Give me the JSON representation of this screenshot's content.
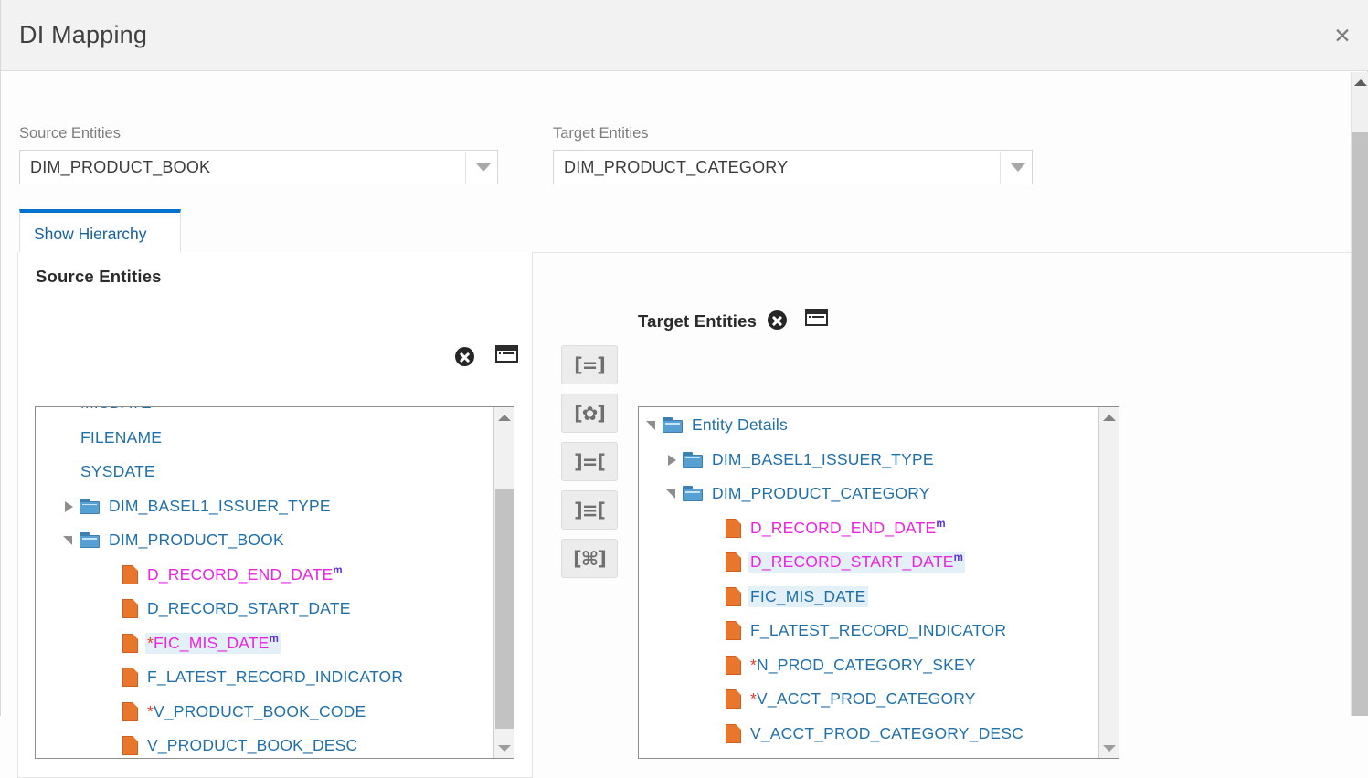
{
  "dialog": {
    "title": "DI Mapping",
    "close_label": "✕"
  },
  "source_field": {
    "label": "Source Entities",
    "value": "DIM_PRODUCT_BOOK"
  },
  "target_field": {
    "label": "Target Entities",
    "value": "DIM_PRODUCT_CATEGORY"
  },
  "tabs": [
    {
      "label": "Show Hierarchy",
      "active": true
    }
  ],
  "source_panel": {
    "title": "Source Entities",
    "clear_icon": "circle-x-icon",
    "list_icon": "list-view-icon",
    "tree": [
      {
        "indent": 1,
        "type": "leaf",
        "text": "MISDATE",
        "color": "blue",
        "asterisk": false,
        "sup": "",
        "selected": false,
        "twisty": "none",
        "partial_top": true
      },
      {
        "indent": 1,
        "type": "leaf",
        "text": "FILENAME",
        "color": "blue",
        "asterisk": false,
        "sup": "",
        "selected": false,
        "twisty": "none"
      },
      {
        "indent": 1,
        "type": "leaf",
        "text": "SYSDATE",
        "color": "blue",
        "asterisk": false,
        "sup": "",
        "selected": false,
        "twisty": "none"
      },
      {
        "indent": 2,
        "type": "folder",
        "text": "DIM_BASEL1_ISSUER_TYPE",
        "color": "blue",
        "asterisk": false,
        "sup": "",
        "selected": false,
        "twisty": "collapsed"
      },
      {
        "indent": 2,
        "type": "folder",
        "text": "DIM_PRODUCT_BOOK",
        "color": "blue",
        "asterisk": false,
        "sup": "",
        "selected": false,
        "twisty": "expanded"
      },
      {
        "indent": 3,
        "type": "leaf",
        "text": "D_RECORD_END_DATE",
        "color": "magenta",
        "asterisk": false,
        "sup": "m",
        "selected": false,
        "twisty": "none"
      },
      {
        "indent": 3,
        "type": "leaf",
        "text": "D_RECORD_START_DATE",
        "color": "blue",
        "asterisk": false,
        "sup": "",
        "selected": false,
        "twisty": "none"
      },
      {
        "indent": 3,
        "type": "leaf",
        "text": "FIC_MIS_DATE",
        "color": "magenta",
        "asterisk": true,
        "sup": "m",
        "selected": true,
        "twisty": "none"
      },
      {
        "indent": 3,
        "type": "leaf",
        "text": "F_LATEST_RECORD_INDICATOR",
        "color": "blue",
        "asterisk": false,
        "sup": "",
        "selected": false,
        "twisty": "none"
      },
      {
        "indent": 3,
        "type": "leaf",
        "text": "V_PRODUCT_BOOK_CODE",
        "color": "blue",
        "asterisk": true,
        "sup": "",
        "selected": false,
        "twisty": "none"
      },
      {
        "indent": 3,
        "type": "leaf",
        "text": "V_PRODUCT_BOOK_DESC",
        "color": "blue",
        "asterisk": false,
        "sup": "",
        "selected": false,
        "twisty": "none"
      }
    ],
    "scrollbar": {
      "up": "scroll-up-arrow",
      "down": "scroll-down-arrow"
    }
  },
  "target_panel": {
    "title": "Target Entities",
    "clear_icon": "circle-x-icon",
    "list_icon": "list-view-icon",
    "tree": [
      {
        "indent": 0,
        "type": "folder",
        "text": "Entity Details",
        "color": "blue",
        "asterisk": false,
        "sup": "",
        "selected": false,
        "twisty": "expanded"
      },
      {
        "indent": 2,
        "type": "folder",
        "text": "DIM_BASEL1_ISSUER_TYPE",
        "color": "blue",
        "asterisk": false,
        "sup": "",
        "selected": false,
        "twisty": "collapsed"
      },
      {
        "indent": 2,
        "type": "folder",
        "text": "DIM_PRODUCT_CATEGORY",
        "color": "blue",
        "asterisk": false,
        "sup": "",
        "selected": false,
        "twisty": "expanded"
      },
      {
        "indent": 3,
        "type": "leaf",
        "text": "D_RECORD_END_DATE",
        "color": "magenta",
        "asterisk": false,
        "sup": "m",
        "selected": false,
        "twisty": "none"
      },
      {
        "indent": 3,
        "type": "leaf",
        "text": "D_RECORD_START_DATE",
        "color": "magenta",
        "asterisk": false,
        "sup": "m",
        "selected": true,
        "twisty": "none"
      },
      {
        "indent": 3,
        "type": "leaf",
        "text": "FIC_MIS_DATE",
        "color": "blue",
        "asterisk": false,
        "sup": "",
        "selected": true,
        "twisty": "none"
      },
      {
        "indent": 3,
        "type": "leaf",
        "text": "F_LATEST_RECORD_INDICATOR",
        "color": "blue",
        "asterisk": false,
        "sup": "",
        "selected": false,
        "twisty": "none"
      },
      {
        "indent": 3,
        "type": "leaf",
        "text": "N_PROD_CATEGORY_SKEY",
        "color": "blue",
        "asterisk": true,
        "sup": "",
        "selected": false,
        "twisty": "none"
      },
      {
        "indent": 3,
        "type": "leaf",
        "text": "V_ACCT_PROD_CATEGORY",
        "color": "blue",
        "asterisk": true,
        "sup": "",
        "selected": false,
        "twisty": "none"
      },
      {
        "indent": 3,
        "type": "leaf",
        "text": "V_ACCT_PROD_CATEGORY_DESC",
        "color": "blue",
        "asterisk": false,
        "sup": "",
        "selected": false,
        "twisty": "none"
      }
    ],
    "scrollbar": {
      "up": "scroll-up-arrow",
      "down": "scroll-down-arrow"
    }
  },
  "op_buttons": [
    {
      "glyph": "[=]",
      "name": "map-equal-button"
    },
    {
      "glyph": "[✿]",
      "name": "map-function-button"
    },
    {
      "glyph": "]=[",
      "name": "unmap-equal-button"
    },
    {
      "glyph": "]≡[",
      "name": "unmap-all-button"
    },
    {
      "glyph": "[⌘]",
      "name": "auto-map-button"
    }
  ],
  "colors": {
    "accent": "#0572ce",
    "tab_text": "#16609e",
    "node_blue": "#1f6fa8",
    "node_magenta": "#ea24e0",
    "asterisk_red": "#e8392e",
    "superscript_purple": "#5b32d6",
    "selected_bg": "#e4f0f8",
    "folder_blue": "#57a0d3",
    "file_orange": "#e8762c",
    "titlebar_bg": "#f2f2f2"
  }
}
